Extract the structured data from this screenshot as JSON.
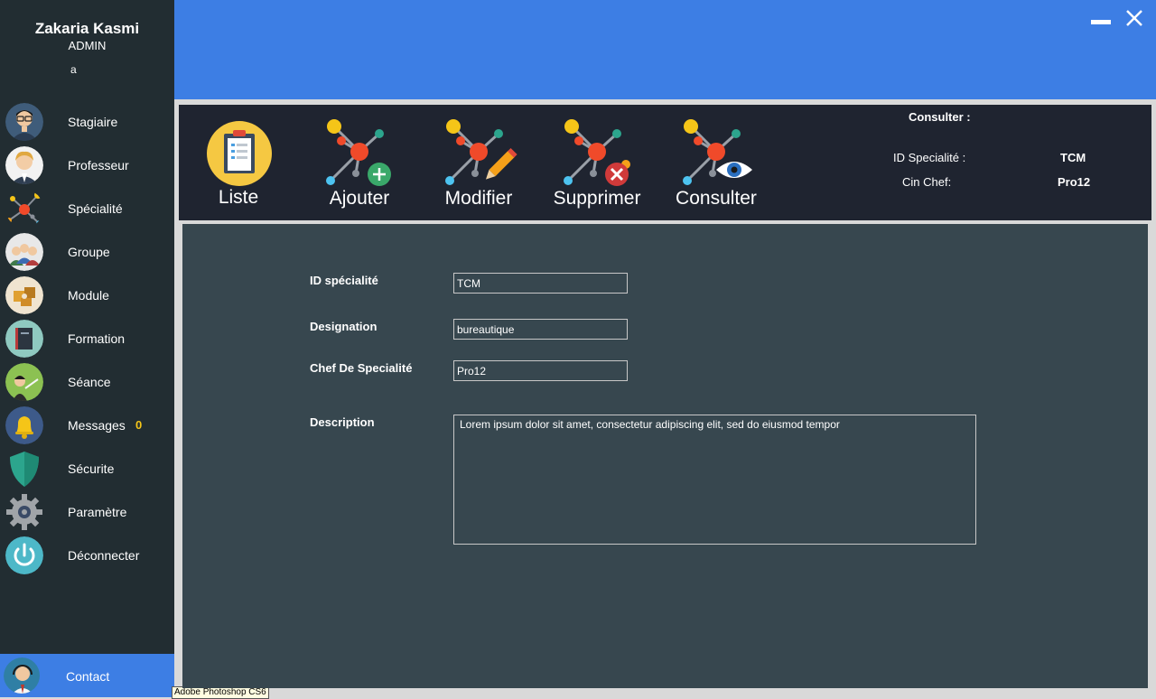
{
  "user": {
    "name": "Zakaria Kasmi",
    "role": "ADMIN",
    "mark": "a"
  },
  "sidebar": {
    "items": [
      {
        "label": "Stagiaire",
        "icon": "stagiaire-icon"
      },
      {
        "label": "Professeur",
        "icon": "professeur-icon"
      },
      {
        "label": "Spécialité",
        "icon": "specialite-icon"
      },
      {
        "label": "Groupe",
        "icon": "groupe-icon"
      },
      {
        "label": "Module",
        "icon": "module-icon"
      },
      {
        "label": "Formation",
        "icon": "formation-icon"
      },
      {
        "label": "Séance",
        "icon": "seance-icon"
      },
      {
        "label": "Messages",
        "icon": "bell-icon",
        "badge": "0"
      },
      {
        "label": "Sécurite",
        "icon": "shield-icon"
      },
      {
        "label": "Paramètre",
        "icon": "gear-icon"
      },
      {
        "label": "Déconnecter",
        "icon": "power-icon"
      }
    ],
    "contact": {
      "label": "Contact",
      "icon": "contact-icon",
      "active_color": "#3d7ee4"
    }
  },
  "tooltip": "Adobe Photoshop CS6",
  "toolbar": {
    "liste": "Liste",
    "ajouter": "Ajouter",
    "modifier": "Modifier",
    "supprimer": "Supprimer",
    "consulter": "Consulter"
  },
  "consult_panel": {
    "title": "Consulter :",
    "id_label": "ID Specialité :",
    "id_value": "TCM",
    "chef_label": "Cin Chef:",
    "chef_value": "Pro12"
  },
  "form": {
    "id_label": "ID spécialité",
    "id_value": "TCM",
    "designation_label": "Designation",
    "designation_value": "bureautique",
    "chef_label": "Chef De Specialité",
    "chef_value": "Pro12",
    "description_label": "Description",
    "description_value": "Lorem ipsum dolor sit amet, consectetur adipiscing elit, sed do eiusmod tempor"
  },
  "colors": {
    "sidebar_bg": "#222d32",
    "accent_blue": "#3d7ee4",
    "toolbar_bg": "#1f2430",
    "content_bg": "#37474f",
    "badge": "#f5c518"
  }
}
